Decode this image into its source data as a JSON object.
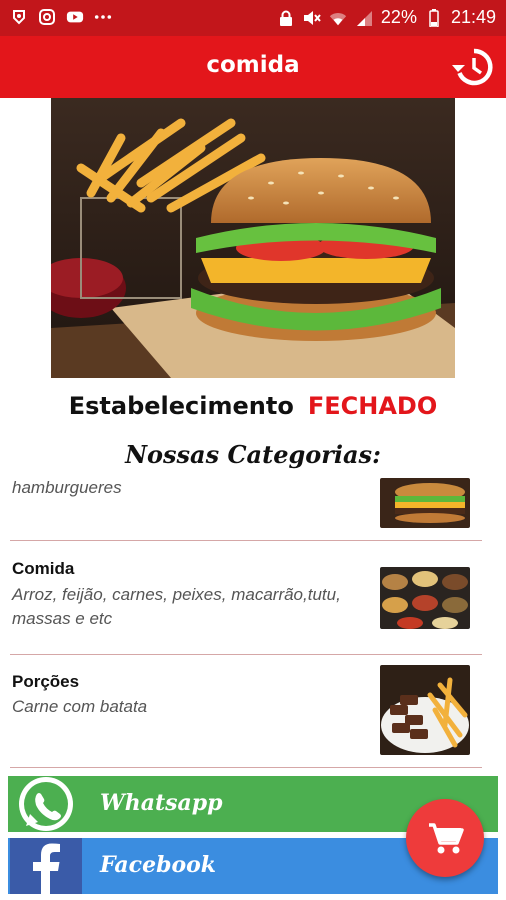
{
  "status_bar": {
    "battery": "22%",
    "time": "21:49",
    "icons": [
      "app-notification-icon",
      "instagram-icon",
      "youtube-icon",
      "more-dots-icon",
      "lock-icon",
      "mute-icon",
      "wifi-icon",
      "signal-icon",
      "battery-icon"
    ]
  },
  "appbar": {
    "title": "comida",
    "history_icon": "history-icon"
  },
  "establishment": {
    "label": "Estabelecimento",
    "status": "FECHADO"
  },
  "categories_title": "Nossas Categorias:",
  "categories": [
    {
      "name": "",
      "description": "hamburgueres"
    },
    {
      "name": "Comida",
      "description": "Arroz, feijão, carnes, peixes, macarrão,tutu, massas e etc"
    },
    {
      "name": "Porções",
      "description": "Carne com batata"
    }
  ],
  "buttons": {
    "whatsapp": "Whatsapp",
    "facebook": "Facebook"
  },
  "fab_icon": "shopping-cart-icon",
  "colors": {
    "status_bar": "#c2161b",
    "app_bar": "#e3161b",
    "closed_status": "#e3161b",
    "whatsapp": "#4caf50",
    "facebook": "#3b8de0",
    "fab": "#ee3b3b"
  }
}
